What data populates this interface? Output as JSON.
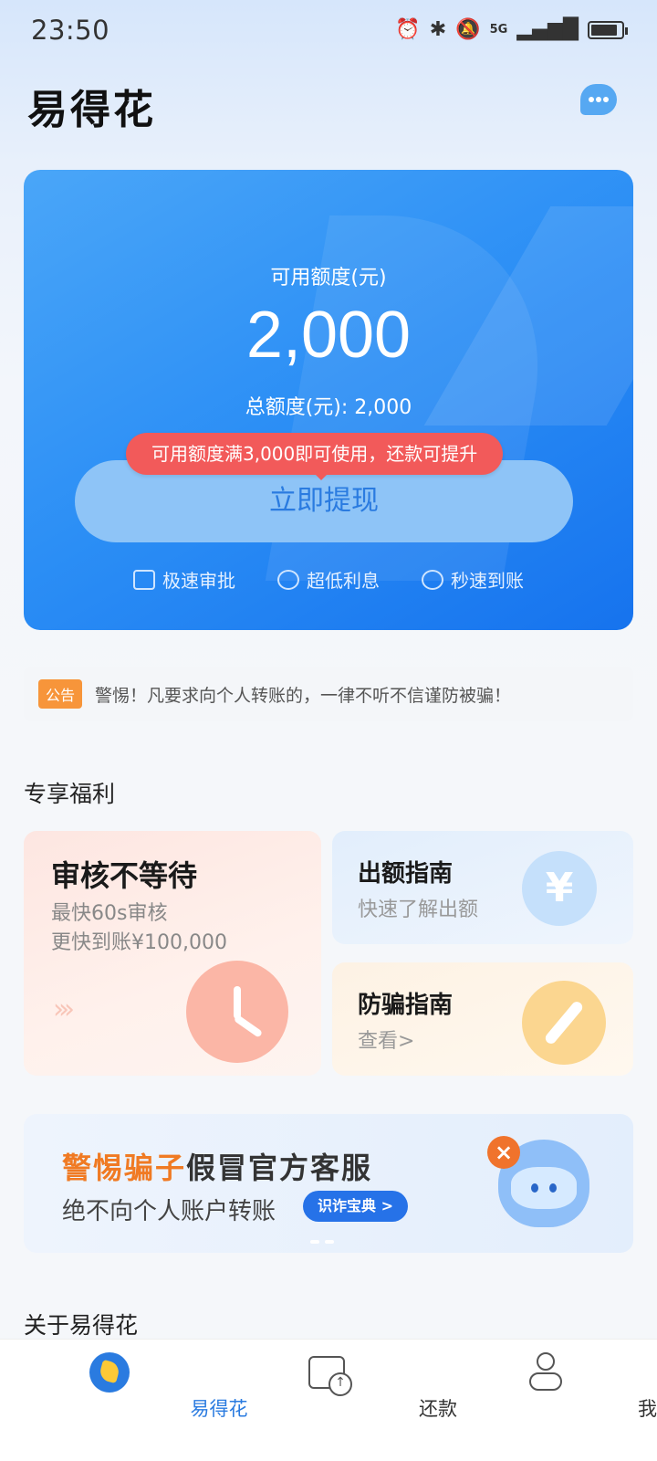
{
  "status_bar": {
    "time": "23:50",
    "network": "5G"
  },
  "header": {
    "title": "易得花",
    "chat_icon": "customer-service-chat-icon"
  },
  "credit_card": {
    "label": "可用额度(元)",
    "amount": "2,000",
    "total": "总额度(元): 2,000",
    "tooltip": "可用额度满3,000即可使用，还款可提升",
    "button": "立即提现",
    "features": [
      {
        "label": "极速审批",
        "icon": "approval-icon"
      },
      {
        "label": "超低利息",
        "icon": "coins-icon"
      },
      {
        "label": "秒速到账",
        "icon": "clock-icon"
      }
    ]
  },
  "notice": {
    "tag": "公告",
    "text": "警惕！凡要求向个人转账的，一律不听不信谨防被骗！"
  },
  "benefits": {
    "title": "专享福利",
    "big": {
      "title": "审核不等待",
      "line1": "最快60s审核",
      "line2": "更快到账¥100,000",
      "chevrons": "›››"
    },
    "guide": {
      "title": "出额指南",
      "sub": "快速了解出额",
      "symbol": "¥"
    },
    "fraud": {
      "title": "防骗指南",
      "sub": "查看>"
    }
  },
  "banner": {
    "title_highlight": "警惕骗子",
    "title_rest": "假冒官方客服",
    "sub": "绝不向个人账户转账",
    "button": "识诈宝典 >",
    "mark": "×"
  },
  "about": {
    "title": "关于易得花"
  },
  "bottom_nav": [
    {
      "label": "易得花",
      "active": true
    },
    {
      "label": "还款",
      "active": false
    },
    {
      "label": "我的",
      "active": false
    }
  ],
  "colors": {
    "primary": "#2a7be0",
    "alert": "#f25a5a",
    "notice_tag": "#f7953a",
    "warning_text": "#f07a23"
  }
}
